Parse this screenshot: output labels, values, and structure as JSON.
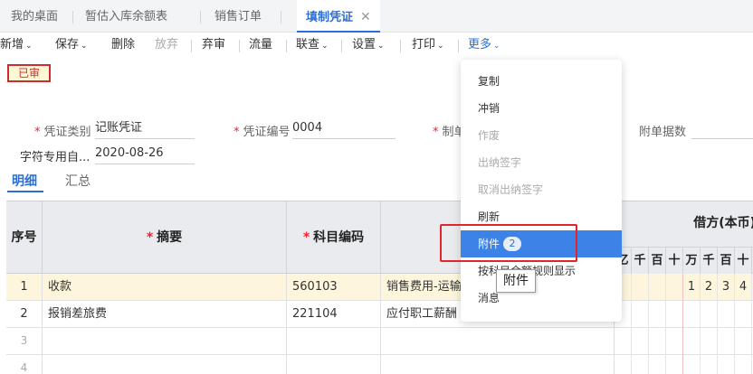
{
  "tabs": [
    {
      "label": "我的桌面"
    },
    {
      "label": "暂估入库余额表"
    },
    {
      "label": "销售订单"
    },
    {
      "label": "填制凭证",
      "close": "✕"
    }
  ],
  "toolbar": {
    "new": "新增",
    "save": "保存",
    "delete": "删除",
    "discard": "放弃",
    "unaudit": "弃审",
    "flow": "流量",
    "link": "联查",
    "settings": "设置",
    "print": "打印",
    "more": "更多",
    "chevron": "⌄"
  },
  "status": {
    "badge": "已审"
  },
  "form": {
    "voucher_type_label": "凭证类别",
    "voucher_type_value": "记账凭证",
    "voucher_no_label": "凭证编号",
    "voucher_no_value": "0004",
    "maker_label_partial": "制单",
    "attach_count_label": "附单据数",
    "custom_field_label": "字符专用自...",
    "date_value": "2020-08-26"
  },
  "subtabs": {
    "detail": "明细",
    "summary": "汇总"
  },
  "table": {
    "headers": {
      "seq": "序号",
      "summary": "摘要",
      "account_code": "科目编码",
      "debit": "借方(本币)"
    },
    "digit_headers": [
      "亿",
      "千",
      "百",
      "十",
      "万",
      "千",
      "百",
      "十"
    ],
    "rows": [
      {
        "seq": "1",
        "summary": "收款",
        "code": "560103",
        "name": "销售费用-运输",
        "digits": [
          "",
          "",
          "",
          "",
          "1",
          "2",
          "3",
          "4"
        ]
      },
      {
        "seq": "2",
        "summary": "报销差旅费",
        "code": "221104",
        "name": "应付职工薪酬",
        "digits": [
          "",
          "",
          "",
          "",
          "",
          "",
          "",
          ""
        ]
      },
      {
        "seq": "3",
        "summary": "",
        "code": "",
        "name": "",
        "digits": [
          "",
          "",
          "",
          "",
          "",
          "",
          "",
          ""
        ]
      },
      {
        "seq": "4",
        "summary": "",
        "code": "",
        "name": "",
        "digits": [
          "",
          "",
          "",
          "",
          "",
          "",
          "",
          ""
        ]
      }
    ]
  },
  "more_menu": {
    "items": [
      {
        "label": "复制",
        "disabled": false
      },
      {
        "label": "冲销",
        "disabled": false
      },
      {
        "label": "作废",
        "disabled": true
      },
      {
        "label": "出纳签字",
        "disabled": true
      },
      {
        "label": "取消出纳签字",
        "disabled": true
      },
      {
        "label": "刷新",
        "disabled": false
      },
      {
        "label": "附件",
        "disabled": false,
        "badge": "2",
        "highlighted": true
      },
      {
        "label": "按科目余额规则显示",
        "disabled": false
      },
      {
        "label": "消息",
        "disabled": false
      }
    ],
    "tooltip": "附件"
  },
  "colors": {
    "accent": "#2b6fd4",
    "highlight": "#3d82e6",
    "danger": "#e0262a"
  }
}
